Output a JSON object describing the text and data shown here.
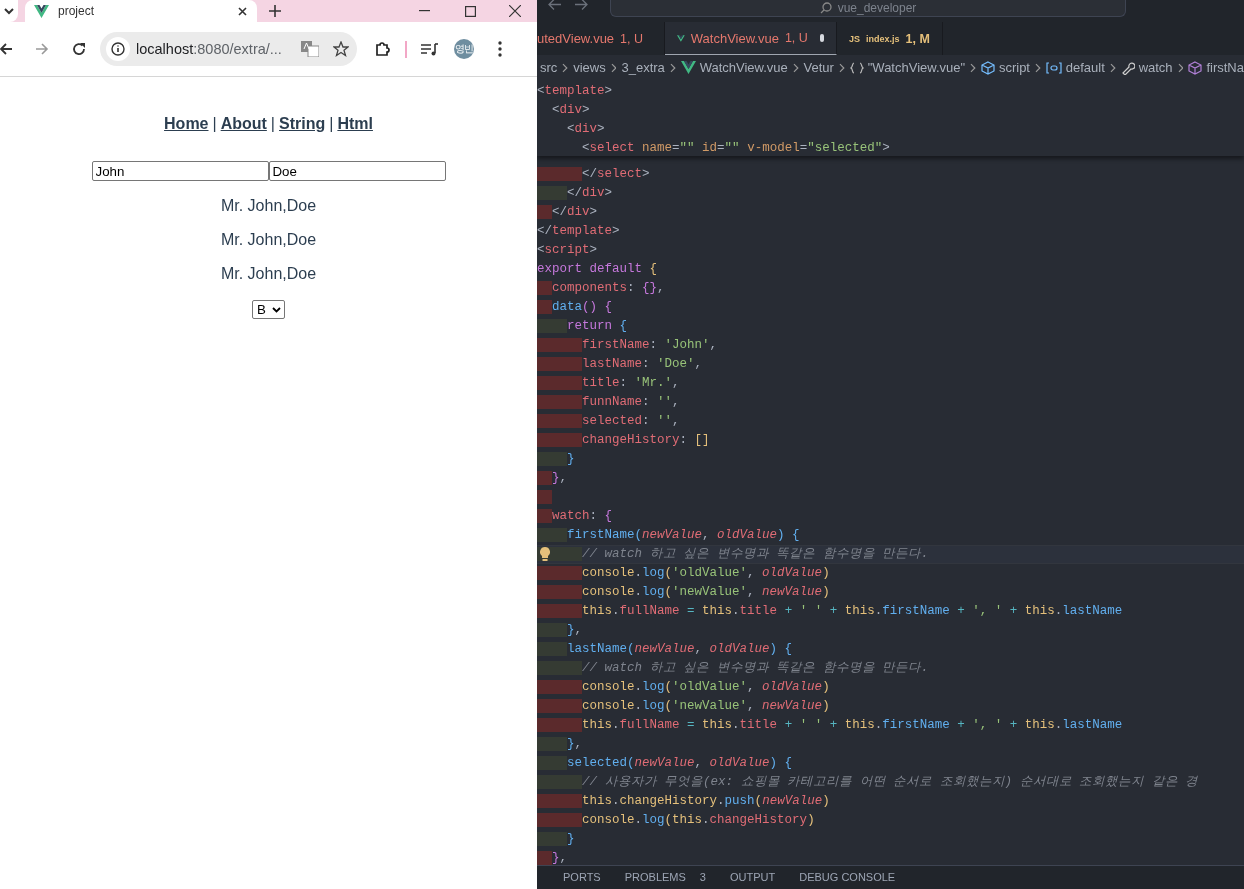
{
  "browser": {
    "tab_title": "project",
    "url_host": "localhost",
    "url_rest": ":8080/extra/...",
    "avatar": "영빈",
    "nav": [
      {
        "kind": "link",
        "text": "Home"
      },
      {
        "kind": "separator",
        "text": "|"
      },
      {
        "kind": "link",
        "text": "About"
      },
      {
        "kind": "separator",
        "text": "|"
      },
      {
        "kind": "link",
        "text": "String"
      },
      {
        "kind": "separator",
        "text": "|"
      },
      {
        "kind": "link",
        "text": "Html"
      }
    ],
    "inputs": [
      {
        "value": "John"
      },
      {
        "value": "Doe"
      }
    ],
    "outputs": [
      "Mr. John,Doe",
      "Mr. John,Doe",
      "Mr. John,Doe"
    ],
    "select": {
      "value": "B"
    }
  },
  "editor": {
    "search": "vue_developer",
    "tabs": [
      {
        "kind": "cut",
        "name": "utedView.vue",
        "status": "1, U",
        "selected": false,
        "dirty": false
      },
      {
        "kind": "vue",
        "name": "WatchView.vue",
        "status": "1, U",
        "selected": true,
        "dirty": true
      },
      {
        "kind": "js",
        "icon_text": "JS",
        "name": "index.js",
        "status": "1, M",
        "selected": false,
        "dirty": false
      }
    ],
    "breadcrumb": [
      {
        "kind": "plain",
        "text": "src"
      },
      {
        "kind": "plain",
        "text": "views"
      },
      {
        "kind": "plain",
        "text": "3_extra"
      },
      {
        "kind": "vue",
        "text": "WatchView.vue"
      },
      {
        "kind": "plain",
        "text": "Vetur"
      },
      {
        "kind": "braces",
        "text": "\"WatchView.vue\""
      },
      {
        "kind": "cube",
        "text": "script"
      },
      {
        "kind": "symbol",
        "text": "default"
      },
      {
        "kind": "wrench",
        "text": "watch"
      },
      {
        "kind": "box",
        "text": "firstNa"
      }
    ],
    "sticky": [
      {
        "tokens": [
          {
            "text": "<",
            "kind": "punct"
          },
          {
            "text": "template",
            "kind": "tag"
          },
          {
            "text": ">",
            "kind": "punct"
          }
        ]
      },
      {
        "tokens": [
          {
            "text": "  <",
            "kind": "punct"
          },
          {
            "text": "div",
            "kind": "tag"
          },
          {
            "text": ">",
            "kind": "punct"
          }
        ]
      },
      {
        "tokens": [
          {
            "text": "    <",
            "kind": "punct"
          },
          {
            "text": "div",
            "kind": "tag"
          },
          {
            "text": ">",
            "kind": "punct"
          }
        ]
      },
      {
        "tokens": [
          {
            "text": "      <",
            "kind": "punct"
          },
          {
            "text": "select",
            "kind": "tag"
          },
          {
            "text": " name",
            "kind": "attr"
          },
          {
            "text": "=",
            "kind": "punct"
          },
          {
            "text": "\"\"",
            "kind": "string"
          },
          {
            "text": " id",
            "kind": "attr"
          },
          {
            "text": "=",
            "kind": "punct"
          },
          {
            "text": "\"\"",
            "kind": "string"
          },
          {
            "text": " v-model",
            "kind": "attr"
          },
          {
            "text": "=",
            "kind": "punct"
          },
          {
            "text": "\"selected\"",
            "kind": "string"
          },
          {
            "text": ">",
            "kind": "punct"
          }
        ]
      }
    ],
    "lines": [
      {
        "warn": true,
        "current": false,
        "tokens": [
          {
            "text": "      </",
            "kind": "punct"
          },
          {
            "text": "select",
            "kind": "tag"
          },
          {
            "text": ">",
            "kind": "punct"
          }
        ]
      },
      {
        "warn": false,
        "current": false,
        "tokens": [
          {
            "text": "    </",
            "kind": "punct"
          },
          {
            "text": "div",
            "kind": "tag"
          },
          {
            "text": ">",
            "kind": "punct"
          }
        ]
      },
      {
        "warn": true,
        "current": false,
        "tokens": [
          {
            "text": "  </",
            "kind": "punct"
          },
          {
            "text": "div",
            "kind": "tag"
          },
          {
            "text": ">",
            "kind": "punct"
          }
        ]
      },
      {
        "current": false,
        "tokens": [
          {
            "text": "</",
            "kind": "punct"
          },
          {
            "text": "template",
            "kind": "tag"
          },
          {
            "text": ">",
            "kind": "punct"
          }
        ]
      },
      {
        "current": false,
        "tokens": [
          {
            "text": "<",
            "kind": "punct"
          },
          {
            "text": "script",
            "kind": "tag"
          },
          {
            "text": ">",
            "kind": "punct"
          }
        ]
      },
      {
        "current": false,
        "tokens": [
          {
            "text": "export default ",
            "kind": "keyword"
          },
          {
            "text": "{",
            "kind": "brace1"
          }
        ]
      },
      {
        "warn": true,
        "current": false,
        "tokens": [
          {
            "text": "  components",
            "kind": "prop"
          },
          {
            "text": ": ",
            "kind": "punct"
          },
          {
            "text": "{}",
            "kind": "brace2"
          },
          {
            "text": ",",
            "kind": "punct"
          }
        ]
      },
      {
        "warn": true,
        "current": false,
        "tokens": [
          {
            "text": "  data",
            "kind": "func"
          },
          {
            "text": "() {",
            "kind": "brace2"
          }
        ]
      },
      {
        "warn": false,
        "current": false,
        "tokens": [
          {
            "text": "    return ",
            "kind": "keyword"
          },
          {
            "text": "{",
            "kind": "brace3"
          }
        ]
      },
      {
        "warn": true,
        "current": false,
        "tokens": [
          {
            "text": "      firstName",
            "kind": "prop"
          },
          {
            "text": ": ",
            "kind": "punct"
          },
          {
            "text": "'John'",
            "kind": "string"
          },
          {
            "text": ",",
            "kind": "punct"
          }
        ]
      },
      {
        "warn": true,
        "current": false,
        "tokens": [
          {
            "text": "      lastName",
            "kind": "prop"
          },
          {
            "text": ": ",
            "kind": "punct"
          },
          {
            "text": "'Doe'",
            "kind": "string"
          },
          {
            "text": ",",
            "kind": "punct"
          }
        ]
      },
      {
        "warn": true,
        "current": false,
        "tokens": [
          {
            "text": "      title",
            "kind": "prop"
          },
          {
            "text": ": ",
            "kind": "punct"
          },
          {
            "text": "'Mr.'",
            "kind": "string"
          },
          {
            "text": ",",
            "kind": "punct"
          }
        ]
      },
      {
        "warn": true,
        "current": false,
        "tokens": [
          {
            "text": "      funnName",
            "kind": "prop"
          },
          {
            "text": ": ",
            "kind": "punct"
          },
          {
            "text": "''",
            "kind": "string"
          },
          {
            "text": ",",
            "kind": "punct"
          }
        ]
      },
      {
        "warn": true,
        "current": false,
        "tokens": [
          {
            "text": "      selected",
            "kind": "prop"
          },
          {
            "text": ": ",
            "kind": "punct"
          },
          {
            "text": "''",
            "kind": "string"
          },
          {
            "text": ",",
            "kind": "punct"
          }
        ]
      },
      {
        "warn": true,
        "current": false,
        "tokens": [
          {
            "text": "      changeHistory",
            "kind": "prop"
          },
          {
            "text": ": ",
            "kind": "punct"
          },
          {
            "text": "[]",
            "kind": "brace1"
          }
        ]
      },
      {
        "warn": false,
        "current": false,
        "tokens": [
          {
            "text": "    }",
            "kind": "brace3"
          }
        ]
      },
      {
        "warn": true,
        "current": false,
        "tokens": [
          {
            "text": "  }",
            "kind": "brace2"
          },
          {
            "text": ",",
            "kind": "punct"
          }
        ]
      },
      {
        "warn": true,
        "current": false
      },
      {
        "warn": true,
        "current": false,
        "tokens": [
          {
            "text": "  watch",
            "kind": "prop"
          },
          {
            "text": ": ",
            "kind": "punct"
          },
          {
            "text": "{",
            "kind": "brace2"
          }
        ]
      },
      {
        "warn": false,
        "current": false,
        "tokens": [
          {
            "text": "    firstName",
            "kind": "func"
          },
          {
            "text": "(",
            "kind": "brace3"
          },
          {
            "text": "newValue",
            "kind": "param"
          },
          {
            "text": ", ",
            "kind": "punct"
          },
          {
            "text": "oldValue",
            "kind": "param"
          },
          {
            "text": ") {",
            "kind": "brace3"
          }
        ]
      },
      {
        "warn": false,
        "current": true,
        "tokens": [
          {
            "text": "      // watch 하고 싶은 변수명과 똑같은 함수명을 만든다.",
            "kind": "comment"
          }
        ]
      },
      {
        "warn": true,
        "current": false,
        "tokens": [
          {
            "text": "      console",
            "kind": "this"
          },
          {
            "text": ".",
            "kind": "punct"
          },
          {
            "text": "log",
            "kind": "func"
          },
          {
            "text": "(",
            "kind": "brace1"
          },
          {
            "text": "'oldValue'",
            "kind": "string"
          },
          {
            "text": ", ",
            "kind": "punct"
          },
          {
            "text": "oldValue",
            "kind": "param"
          },
          {
            "text": ")",
            "kind": "brace1"
          }
        ]
      },
      {
        "warn": true,
        "current": false,
        "tokens": [
          {
            "text": "      console",
            "kind": "this"
          },
          {
            "text": ".",
            "kind": "punct"
          },
          {
            "text": "log",
            "kind": "func"
          },
          {
            "text": "(",
            "kind": "brace1"
          },
          {
            "text": "'newValue'",
            "kind": "string"
          },
          {
            "text": ", ",
            "kind": "punct"
          },
          {
            "text": "newValue",
            "kind": "param"
          },
          {
            "text": ")",
            "kind": "brace1"
          }
        ]
      },
      {
        "warn": true,
        "current": false,
        "tokens": [
          {
            "text": "      this",
            "kind": "this"
          },
          {
            "text": ".",
            "kind": "punct"
          },
          {
            "text": "fullName",
            "kind": "prop"
          },
          {
            "text": " = ",
            "kind": "op"
          },
          {
            "text": "this",
            "kind": "this"
          },
          {
            "text": ".",
            "kind": "punct"
          },
          {
            "text": "title",
            "kind": "prop"
          },
          {
            "text": " + ",
            "kind": "op"
          },
          {
            "text": "' '",
            "kind": "string"
          },
          {
            "text": " + ",
            "kind": "op"
          },
          {
            "text": "this",
            "kind": "this"
          },
          {
            "text": ".",
            "kind": "punct"
          },
          {
            "text": "firstName",
            "kind": "func"
          },
          {
            "text": " + ",
            "kind": "op"
          },
          {
            "text": "', '",
            "kind": "string"
          },
          {
            "text": " + ",
            "kind": "op"
          },
          {
            "text": "this",
            "kind": "this"
          },
          {
            "text": ".",
            "kind": "punct"
          },
          {
            "text": "lastName",
            "kind": "func"
          }
        ]
      },
      {
        "warn": false,
        "current": false,
        "tokens": [
          {
            "text": "    }",
            "kind": "brace3"
          },
          {
            "text": ",",
            "kind": "punct"
          }
        ]
      },
      {
        "warn": false,
        "current": false,
        "tokens": [
          {
            "text": "    lastName",
            "kind": "func"
          },
          {
            "text": "(",
            "kind": "brace3"
          },
          {
            "text": "newValue",
            "kind": "param"
          },
          {
            "text": ", ",
            "kind": "punct"
          },
          {
            "text": "oldValue",
            "kind": "param"
          },
          {
            "text": ") {",
            "kind": "brace3"
          }
        ]
      },
      {
        "warn": false,
        "current": false,
        "tokens": [
          {
            "text": "      // watch 하고 싶은 변수명과 똑같은 함수명을 만든다.",
            "kind": "comment"
          }
        ]
      },
      {
        "warn": true,
        "current": false,
        "tokens": [
          {
            "text": "      console",
            "kind": "this"
          },
          {
            "text": ".",
            "kind": "punct"
          },
          {
            "text": "log",
            "kind": "func"
          },
          {
            "text": "(",
            "kind": "brace1"
          },
          {
            "text": "'oldValue'",
            "kind": "string"
          },
          {
            "text": ", ",
            "kind": "punct"
          },
          {
            "text": "oldValue",
            "kind": "param"
          },
          {
            "text": ")",
            "kind": "brace1"
          }
        ]
      },
      {
        "warn": true,
        "current": false,
        "tokens": [
          {
            "text": "      console",
            "kind": "this"
          },
          {
            "text": ".",
            "kind": "punct"
          },
          {
            "text": "log",
            "kind": "func"
          },
          {
            "text": "(",
            "kind": "brace1"
          },
          {
            "text": "'newValue'",
            "kind": "string"
          },
          {
            "text": ", ",
            "kind": "punct"
          },
          {
            "text": "newValue",
            "kind": "param"
          },
          {
            "text": ")",
            "kind": "brace1"
          }
        ]
      },
      {
        "warn": true,
        "current": false,
        "tokens": [
          {
            "text": "      this",
            "kind": "this"
          },
          {
            "text": ".",
            "kind": "punct"
          },
          {
            "text": "fullName",
            "kind": "prop"
          },
          {
            "text": " = ",
            "kind": "op"
          },
          {
            "text": "this",
            "kind": "this"
          },
          {
            "text": ".",
            "kind": "punct"
          },
          {
            "text": "title",
            "kind": "prop"
          },
          {
            "text": " + ",
            "kind": "op"
          },
          {
            "text": "' '",
            "kind": "string"
          },
          {
            "text": " + ",
            "kind": "op"
          },
          {
            "text": "this",
            "kind": "this"
          },
          {
            "text": ".",
            "kind": "punct"
          },
          {
            "text": "firstName",
            "kind": "func"
          },
          {
            "text": " + ",
            "kind": "op"
          },
          {
            "text": "', '",
            "kind": "string"
          },
          {
            "text": " + ",
            "kind": "op"
          },
          {
            "text": "this",
            "kind": "this"
          },
          {
            "text": ".",
            "kind": "punct"
          },
          {
            "text": "lastName",
            "kind": "func"
          }
        ]
      },
      {
        "warn": false,
        "current": false,
        "tokens": [
          {
            "text": "    }",
            "kind": "brace3"
          },
          {
            "text": ",",
            "kind": "punct"
          }
        ]
      },
      {
        "warn": false,
        "current": false,
        "tokens": [
          {
            "text": "    selected",
            "kind": "func"
          },
          {
            "text": "(",
            "kind": "brace3"
          },
          {
            "text": "newValue",
            "kind": "param"
          },
          {
            "text": ", ",
            "kind": "punct"
          },
          {
            "text": "oldValue",
            "kind": "param"
          },
          {
            "text": ") {",
            "kind": "brace3"
          }
        ]
      },
      {
        "warn": false,
        "current": false,
        "tokens": [
          {
            "text": "      // 사용자가 무엇을(ex: 쇼핑몰 카테고리를 어떤 순서로 조회했는지) 순서대로 조회했는지 같은 경",
            "kind": "comment"
          }
        ]
      },
      {
        "warn": true,
        "current": false,
        "tokens": [
          {
            "text": "      this",
            "kind": "this"
          },
          {
            "text": ".",
            "kind": "punct"
          },
          {
            "text": "changeHistory",
            "kind": "this"
          },
          {
            "text": ".",
            "kind": "punct"
          },
          {
            "text": "push",
            "kind": "func"
          },
          {
            "text": "(",
            "kind": "brace1"
          },
          {
            "text": "newValue",
            "kind": "param"
          },
          {
            "text": ")",
            "kind": "brace1"
          }
        ]
      },
      {
        "warn": true,
        "current": false,
        "tokens": [
          {
            "text": "      console",
            "kind": "this"
          },
          {
            "text": ".",
            "kind": "punct"
          },
          {
            "text": "log",
            "kind": "func"
          },
          {
            "text": "(",
            "kind": "brace1"
          },
          {
            "text": "this",
            "kind": "this"
          },
          {
            "text": ".",
            "kind": "punct"
          },
          {
            "text": "changeHistory",
            "kind": "prop"
          },
          {
            "text": ")",
            "kind": "brace1"
          }
        ]
      },
      {
        "warn": false,
        "current": false,
        "tokens": [
          {
            "text": "    }",
            "kind": "brace3"
          }
        ]
      },
      {
        "warn": true,
        "current": false,
        "tokens": [
          {
            "text": "  }",
            "kind": "brace2"
          },
          {
            "text": ",",
            "kind": "punct"
          }
        ]
      }
    ],
    "panel_tabs": [
      {
        "label": "PORTS"
      },
      {
        "label": "PROBLEMS",
        "count": "3"
      },
      {
        "label": "OUTPUT"
      },
      {
        "label": "DEBUG CONSOLE"
      }
    ]
  }
}
